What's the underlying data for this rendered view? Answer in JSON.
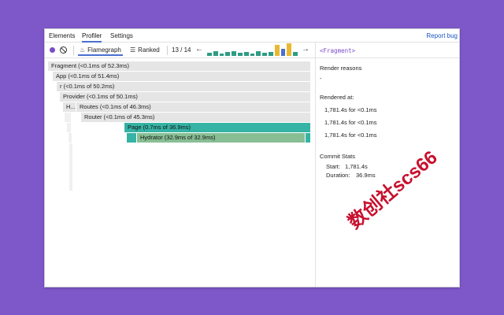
{
  "tabs": [
    {
      "label": "Elements"
    },
    {
      "label": "Profiler"
    },
    {
      "label": "Settings"
    }
  ],
  "report_bug": "Report bug",
  "toolbar": {
    "flamegraph_label": "Flamegraph",
    "ranked_label": "Ranked",
    "commit_counter": "13 / 14",
    "prev_arrow": "←",
    "next_arrow": "→",
    "commit_heights": [
      0.25,
      0.35,
      0.2,
      0.3,
      0.4,
      0.25,
      0.3,
      0.2,
      0.35,
      0.25,
      0.3,
      0.85,
      0.55,
      1.0,
      0.3
    ],
    "commit_colors": [
      "#2e9c84",
      "#2e9c84",
      "#2e9c84",
      "#2e9c84",
      "#2e9c84",
      "#2e9c84",
      "#2e9c84",
      "#2e9c84",
      "#2e9c84",
      "#2e9c84",
      "#2e9c84",
      "#e8b930",
      "#4a6fd1",
      "#e8b930",
      "#2e9c84"
    ]
  },
  "flame": {
    "rows": [
      {
        "label": "Fragment (<0.1ms of 52.3ms)"
      },
      {
        "label": "App (<0.1ms of 51.4ms)"
      },
      {
        "label": "r (<0.1ms of 50.2ms)"
      },
      {
        "label": "Provider (<0.1ms of 50.1ms)"
      },
      {
        "label": "H..."
      },
      {
        "label": "Routes (<0.1ms of 46.3ms)"
      },
      {
        "label": "Router (<0.1ms of 45.3ms)"
      },
      {
        "label": "Page (0.7ms of 36.9ms)"
      },
      {
        "label": "Hydrator (32.9ms of 32.9ms)"
      }
    ]
  },
  "details": {
    "component_name": "<Fragment>",
    "render_reasons_title": "Render reasons",
    "render_reasons_value": "-",
    "rendered_at_title": "Rendered at:",
    "rendered_at": [
      "1,781.4s for <0.1ms",
      "1,781.4s for <0.1ms",
      "1,781.4s for <0.1ms"
    ],
    "commit_stats_title": "Commit Stats",
    "start_label": "Start:",
    "start_value": "1,781.4s",
    "duration_label": "Duration:",
    "duration_value": "36.9ms"
  },
  "watermark": "数创社scs66"
}
